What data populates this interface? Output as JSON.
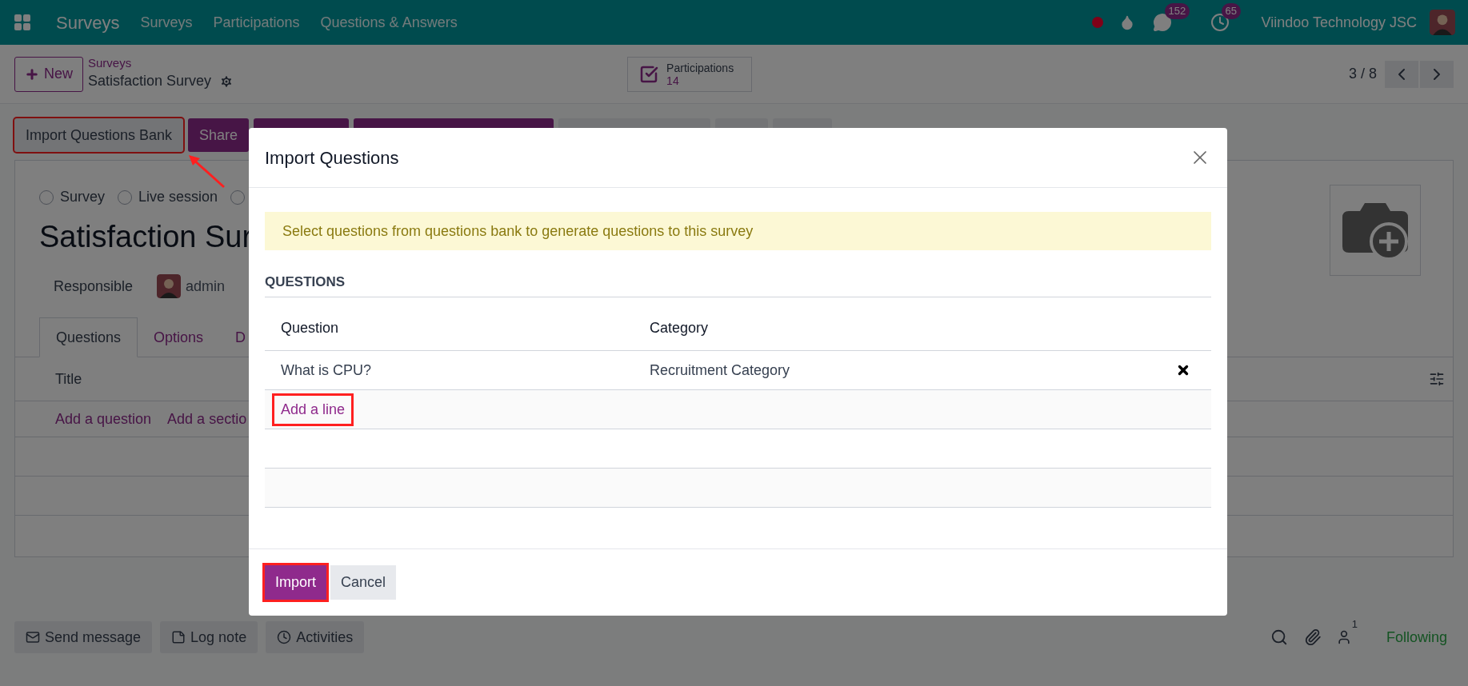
{
  "navbar": {
    "app_name": "Surveys",
    "menu": [
      "Surveys",
      "Participations",
      "Questions & Answers"
    ],
    "chat_count": "152",
    "activity_count": "65",
    "company": "Viindoo Technology JSC"
  },
  "control_panel": {
    "new_button": "New",
    "breadcrumb_parent": "Surveys",
    "breadcrumb_current": "Satisfaction Survey",
    "stat_label": "Participations",
    "stat_value": "14",
    "pager": "3 / 8"
  },
  "action_buttons": [
    {
      "kind": "secondary",
      "label": "Import Questions Bank",
      "highlighted": true
    },
    {
      "kind": "primary",
      "label": "Share",
      "highlighted": false
    },
    {
      "kind": "primary-blank",
      "highlighted": false
    },
    {
      "kind": "primary-blank",
      "highlighted": false
    },
    {
      "kind": "secondary-blank",
      "highlighted": false
    },
    {
      "kind": "secondary-blank",
      "highlighted": false
    },
    {
      "kind": "secondary-blank",
      "highlighted": false
    }
  ],
  "sheet": {
    "survey_types": [
      {
        "label": "Survey",
        "selected": false
      },
      {
        "label": "Live session",
        "selected": false
      },
      {
        "selected": false
      }
    ],
    "title": "Satisfaction Sur",
    "responsible_label": "Responsible",
    "responsible_value": "admin",
    "tabs": [
      {
        "label": "Questions",
        "selected": true
      },
      {
        "label": "Options",
        "selected": false
      },
      {
        "label": "D",
        "selected": false
      }
    ],
    "list_column": "Title",
    "list_actions": [
      "Add a question",
      "Add a sectio"
    ]
  },
  "chatter": {
    "buttons": [
      "Send message",
      "Log note",
      "Activities"
    ],
    "followers_count": "1",
    "follow_label": "Following"
  },
  "modal": {
    "title": "Import Questions",
    "alert": "Select questions from questions bank to generate questions to this survey",
    "section_title": "QUESTIONS",
    "columns": [
      "Question",
      "Category"
    ],
    "rows": [
      {
        "question": "What is CPU?",
        "category": "Recruitment Category"
      }
    ],
    "add_line": {
      "label": "Add a line",
      "highlighted": true
    },
    "buttons": [
      {
        "label": "Import",
        "kind": "primary",
        "highlighted": true
      },
      {
        "label": "Cancel",
        "kind": "secondary",
        "highlighted": false
      }
    ]
  }
}
